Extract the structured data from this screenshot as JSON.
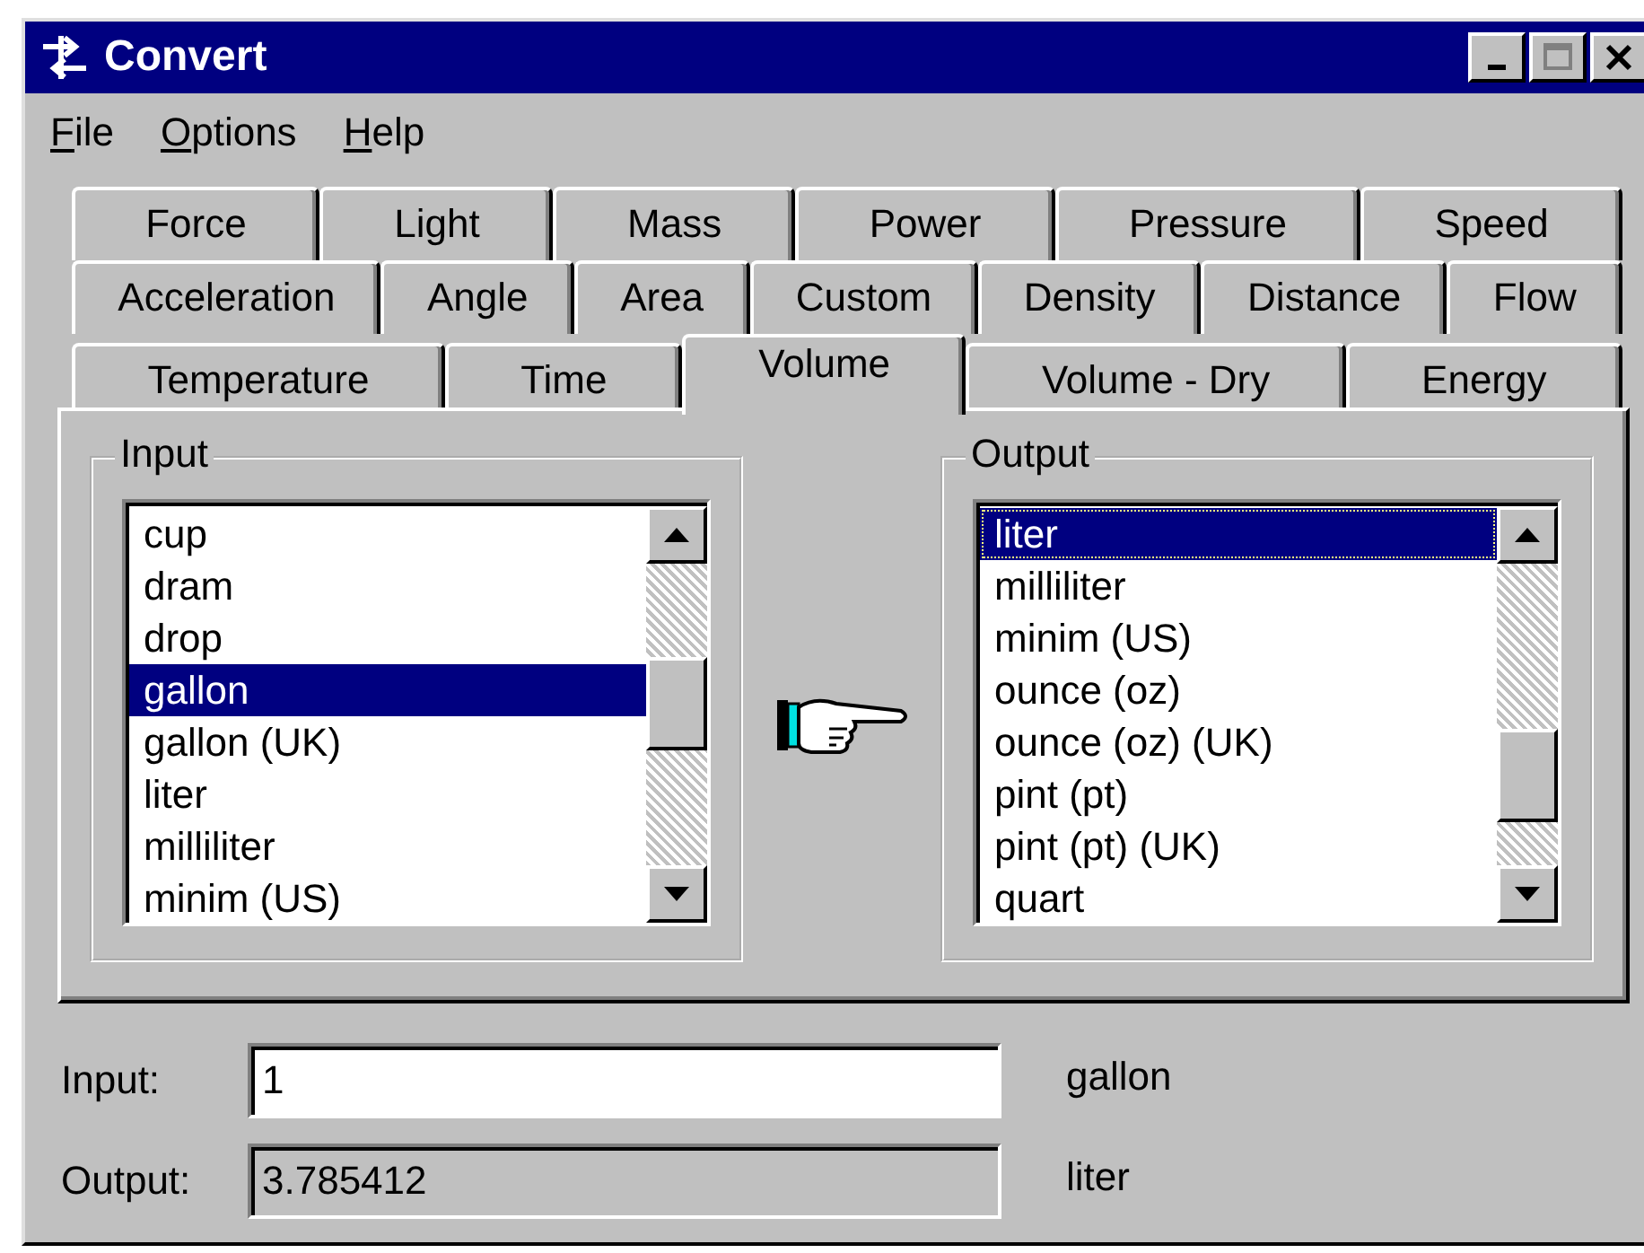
{
  "window": {
    "title": "Convert"
  },
  "menu": [
    {
      "label": "File"
    },
    {
      "label": "Options"
    },
    {
      "label": "Help"
    }
  ],
  "tab_rows": [
    [
      {
        "label": "Force",
        "selected": false
      },
      {
        "label": "Light",
        "selected": false
      },
      {
        "label": "Mass",
        "selected": false
      },
      {
        "label": "Power",
        "selected": false
      },
      {
        "label": "Pressure",
        "selected": false
      },
      {
        "label": "Speed",
        "selected": false
      }
    ],
    [
      {
        "label": "Acceleration",
        "selected": false
      },
      {
        "label": "Angle",
        "selected": false
      },
      {
        "label": "Area",
        "selected": false
      },
      {
        "label": "Custom",
        "selected": false
      },
      {
        "label": "Density",
        "selected": false
      },
      {
        "label": "Distance",
        "selected": false
      },
      {
        "label": "Flow",
        "selected": false
      }
    ],
    [
      {
        "label": "Temperature",
        "selected": false
      },
      {
        "label": "Time",
        "selected": false
      },
      {
        "label": "Volume",
        "selected": true
      },
      {
        "label": "Volume - Dry",
        "selected": false
      },
      {
        "label": "Energy",
        "selected": false
      }
    ]
  ],
  "input_group": {
    "title": "Input",
    "focused": false,
    "items": [
      {
        "label": "cup",
        "selected": false
      },
      {
        "label": "dram",
        "selected": false
      },
      {
        "label": "drop",
        "selected": false
      },
      {
        "label": "gallon",
        "selected": true
      },
      {
        "label": "gallon (UK)",
        "selected": false
      },
      {
        "label": "liter",
        "selected": false
      },
      {
        "label": "milliliter",
        "selected": false
      },
      {
        "label": "minim (US)",
        "selected": false
      }
    ]
  },
  "output_group": {
    "title": "Output",
    "focused": true,
    "items": [
      {
        "label": "liter",
        "selected": true
      },
      {
        "label": "milliliter",
        "selected": false
      },
      {
        "label": "minim (US)",
        "selected": false
      },
      {
        "label": "ounce (oz)",
        "selected": false
      },
      {
        "label": "ounce (oz) (UK)",
        "selected": false
      },
      {
        "label": "pint (pt)",
        "selected": false
      },
      {
        "label": "pint (pt) (UK)",
        "selected": false
      },
      {
        "label": "quart",
        "selected": false
      }
    ]
  },
  "fields": [
    {
      "label": "Input:",
      "value": "1",
      "unit": "gallon",
      "disabled": false
    },
    {
      "label": "Output:",
      "value": "3.785412",
      "unit": "liter",
      "disabled": true
    }
  ]
}
